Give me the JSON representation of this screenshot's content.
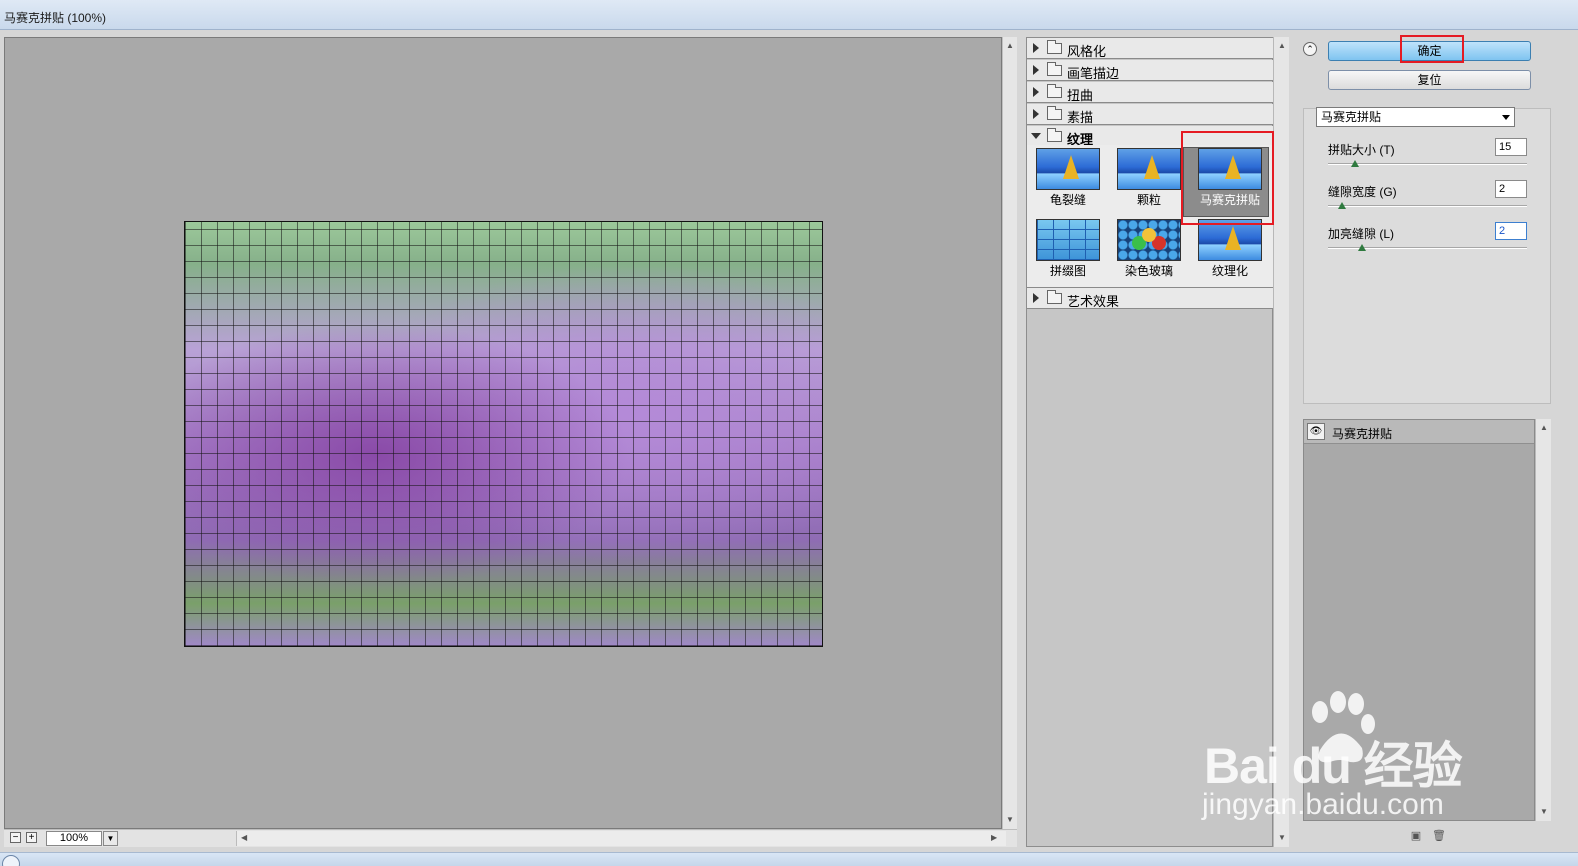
{
  "window": {
    "title": "马赛克拼贴 (100%)"
  },
  "preview": {
    "zoom": "100%",
    "zoom_out": "−",
    "zoom_in": "+"
  },
  "gallery": {
    "categories": [
      {
        "label": "风格化",
        "expanded": false
      },
      {
        "label": "画笔描边",
        "expanded": false
      },
      {
        "label": "扭曲",
        "expanded": false
      },
      {
        "label": "素描",
        "expanded": false
      },
      {
        "label": "纹理",
        "expanded": true
      },
      {
        "label": "艺术效果",
        "expanded": false
      }
    ],
    "texture_filters": [
      {
        "label": "龟裂缝"
      },
      {
        "label": "颗粒"
      },
      {
        "label": "马赛克拼贴",
        "selected": true
      },
      {
        "label": "拼缀图"
      },
      {
        "label": "染色玻璃"
      },
      {
        "label": "纹理化"
      }
    ]
  },
  "actions": {
    "ok_label": "确定",
    "reset_label": "复位"
  },
  "settings": {
    "filter_select": "马赛克拼贴",
    "params": [
      {
        "label": "拼贴大小 (T)",
        "value": "15"
      },
      {
        "label": "缝隙宽度 (G)",
        "value": "2"
      },
      {
        "label": "加亮缝隙 (L)",
        "value": "2"
      }
    ]
  },
  "layers": {
    "items": [
      {
        "name": "马赛克拼贴"
      }
    ]
  },
  "watermark": {
    "brand": "Bai du 经验",
    "url": "jingyan.baidu.com"
  },
  "colors": {
    "highlight": "#e51b23",
    "ok_button": "#7fc4f0",
    "preview_bg": "#a9a9a9"
  }
}
